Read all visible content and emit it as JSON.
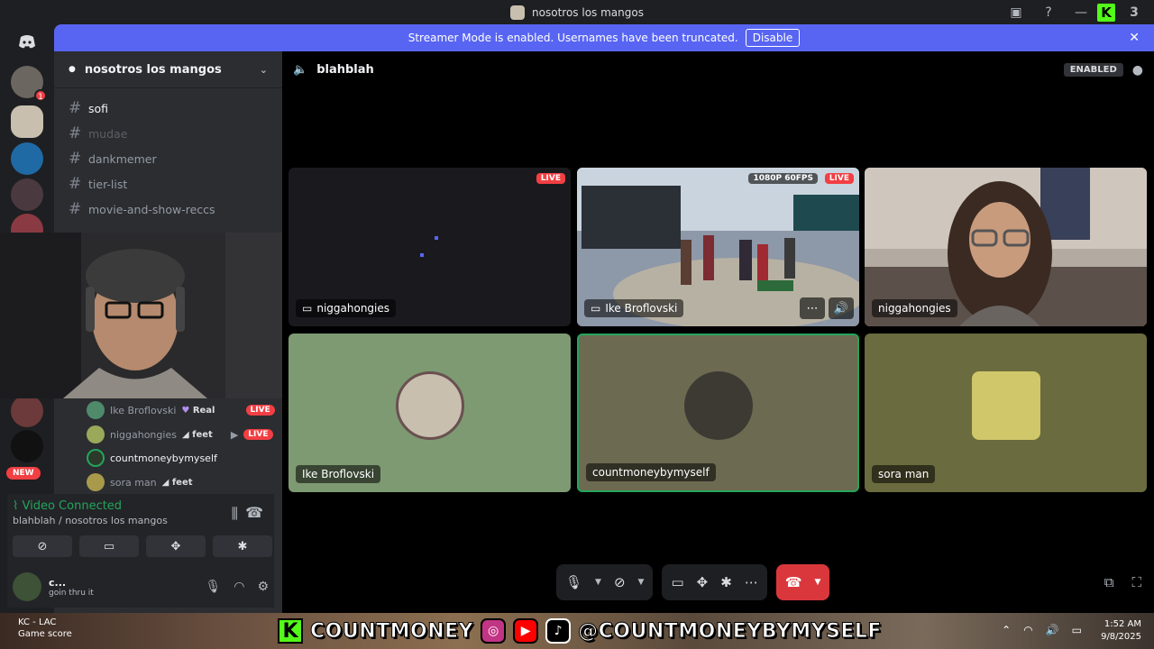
{
  "titlebar": {
    "title": "nosotros los mangos",
    "kick_count": "3"
  },
  "banner": {
    "message": "Streamer Mode is enabled. Usernames have been truncated.",
    "disable_label": "Disable"
  },
  "guilds": {
    "badge_count": "1",
    "new_label": "NEW"
  },
  "sidebar": {
    "server_name": "nosotros los mangos",
    "channels": [
      {
        "name": "sofi"
      },
      {
        "name": "mudae"
      },
      {
        "name": "dankmemer"
      },
      {
        "name": "tier-list"
      },
      {
        "name": "movie-and-show-reccs"
      }
    ],
    "voice_users": [
      {
        "name": "Ike Broflovski",
        "tag": "Real",
        "live": "LIVE"
      },
      {
        "name": "niggahongies",
        "tag": "feet",
        "live": "LIVE"
      },
      {
        "name": "countmoneybymyself",
        "tag": "",
        "live": ""
      },
      {
        "name": "sora man",
        "tag": "feet",
        "live": ""
      }
    ]
  },
  "voice_panel": {
    "status": "Video Connected",
    "channel": "blahblah / nosotros los mangos"
  },
  "user_panel": {
    "name": "c...",
    "status": "goin thru it"
  },
  "main": {
    "channel_name": "blahblah",
    "streamer_badge": "ENABLED",
    "tiles": [
      {
        "name": "niggahongies",
        "live": "LIVE",
        "quality": ""
      },
      {
        "name": "Ike Broflovski",
        "live": "LIVE",
        "quality": "1080P 60FPS"
      },
      {
        "name": "niggahongies",
        "live": "",
        "quality": ""
      },
      {
        "name": "Ike Broflovski",
        "live": "",
        "quality": ""
      },
      {
        "name": "countmoneybymyself",
        "live": "",
        "quality": ""
      },
      {
        "name": "sora man",
        "live": "",
        "quality": ""
      }
    ]
  },
  "taskbar": {
    "weather_title": "KC - LAC",
    "weather_sub": "Game score",
    "brand_text": "COUNTMONEY",
    "handle_text": "@COUNTMONEYBYMYSELF",
    "time": "1:52 AM",
    "date": "9/8/2025"
  },
  "colors": {
    "blurple": "#5865f2",
    "live_red": "#f23f43",
    "connected_green": "#23a55a",
    "kick_green": "#53fc18",
    "leave_red": "#da373c"
  },
  "icons": [
    "discord-icon",
    "inbox-icon",
    "help-icon",
    "close-icon",
    "chevron-down-icon",
    "speaker-icon",
    "screen-icon",
    "mic-icon",
    "camera-off-icon",
    "share-screen-icon",
    "activity-icon",
    "soundboard-icon",
    "more-icon",
    "hangup-icon",
    "popout-icon",
    "fullscreen-icon",
    "headphones-icon",
    "gear-icon"
  ]
}
